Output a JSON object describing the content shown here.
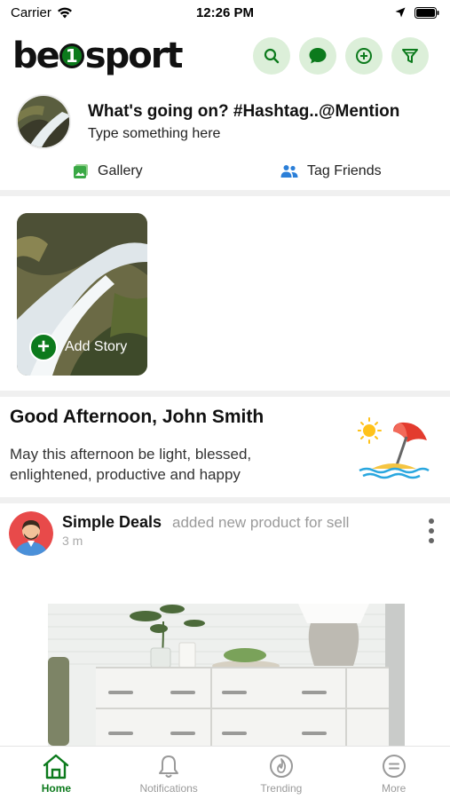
{
  "status_bar": {
    "carrier": "Carrier",
    "time": "12:26 PM"
  },
  "header": {
    "logo": {
      "part1": "be",
      "badge": "1",
      "part2": "sport"
    },
    "actions": [
      "search-icon",
      "chat-icon",
      "add-circle-icon",
      "filter-icon"
    ]
  },
  "composer": {
    "title": "What's going on? #Hashtag..@Mention",
    "placeholder": "Type something here",
    "gallery_label": "Gallery",
    "tag_friends_label": "Tag Friends"
  },
  "story": {
    "add_label": "Add Story"
  },
  "greeting": {
    "title": "Good Afternoon, John Smith",
    "message": "May this afternoon be light, blessed, enlightened, productive and happy"
  },
  "post": {
    "author": "Simple Deals",
    "action": "added new product for sell",
    "time": "3 m"
  },
  "tabs": [
    {
      "label": "Home",
      "icon": "home-icon",
      "active": true
    },
    {
      "label": "Notifications",
      "icon": "bell-icon",
      "active": false
    },
    {
      "label": "Trending",
      "icon": "flame-icon",
      "active": false
    },
    {
      "label": "More",
      "icon": "menu-icon",
      "active": false
    }
  ],
  "colors": {
    "accent": "#0c7a1c",
    "accent_light": "#dcefd9",
    "muted": "#9a9a9a"
  }
}
